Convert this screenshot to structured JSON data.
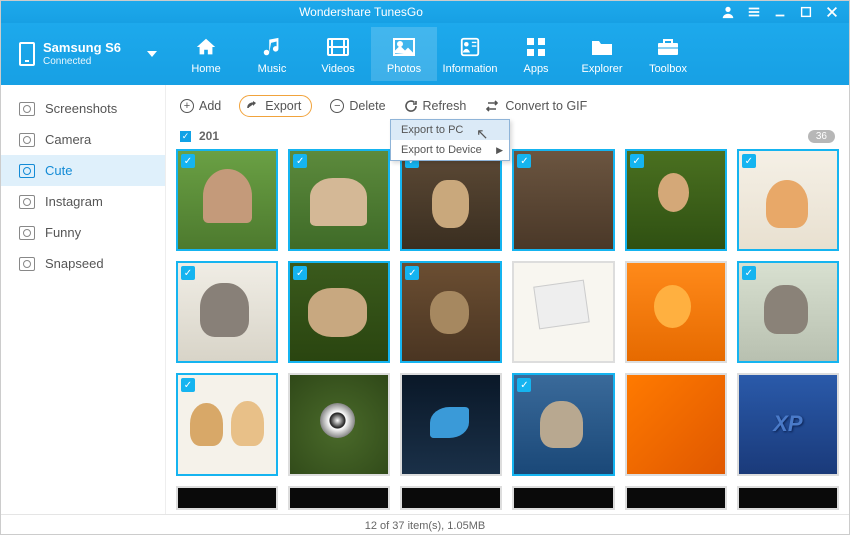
{
  "app_title": "Wondershare TunesGo",
  "device": {
    "name": "Samsung S6",
    "status": "Connected"
  },
  "nav": [
    {
      "id": "home",
      "label": "Home"
    },
    {
      "id": "music",
      "label": "Music"
    },
    {
      "id": "videos",
      "label": "Videos"
    },
    {
      "id": "photos",
      "label": "Photos",
      "active": true
    },
    {
      "id": "information",
      "label": "Information"
    },
    {
      "id": "apps",
      "label": "Apps"
    },
    {
      "id": "explorer",
      "label": "Explorer"
    },
    {
      "id": "toolbox",
      "label": "Toolbox"
    }
  ],
  "sidebar": [
    {
      "label": "Screenshots"
    },
    {
      "label": "Camera"
    },
    {
      "label": "Cute",
      "active": true
    },
    {
      "label": "Instagram"
    },
    {
      "label": "Funny"
    },
    {
      "label": "Snapseed"
    }
  ],
  "toolbar": {
    "add": "Add",
    "export": "Export",
    "delete": "Delete",
    "refresh": "Refresh",
    "gif": "Convert to GIF"
  },
  "export_menu": {
    "pc": "Export to PC",
    "device": "Export to Device"
  },
  "group": {
    "year": "201",
    "count": "36"
  },
  "thumbs": [
    {
      "sel": true,
      "cls": "grass"
    },
    {
      "sel": true,
      "cls": "basket"
    },
    {
      "sel": true,
      "cls": "wood"
    },
    {
      "sel": true,
      "cls": "wood2"
    },
    {
      "sel": true,
      "cls": "tree"
    },
    {
      "sel": true,
      "cls": "chair"
    },
    {
      "sel": true,
      "cls": "graycat"
    },
    {
      "sel": true,
      "cls": "kitten2"
    },
    {
      "sel": true,
      "cls": "woodcat"
    },
    {
      "sel": false,
      "cls": "paper"
    },
    {
      "sel": false,
      "cls": "orange"
    },
    {
      "sel": true,
      "cls": "catgrey"
    },
    {
      "sel": true,
      "cls": "twokit"
    },
    {
      "sel": false,
      "cls": "xpgreen"
    },
    {
      "sel": false,
      "cls": "butterfly"
    },
    {
      "sel": true,
      "cls": "bluecat"
    },
    {
      "sel": false,
      "cls": "xporange"
    },
    {
      "sel": false,
      "cls": "xpblue"
    }
  ],
  "status": "12 of 37 item(s), 1.05MB"
}
